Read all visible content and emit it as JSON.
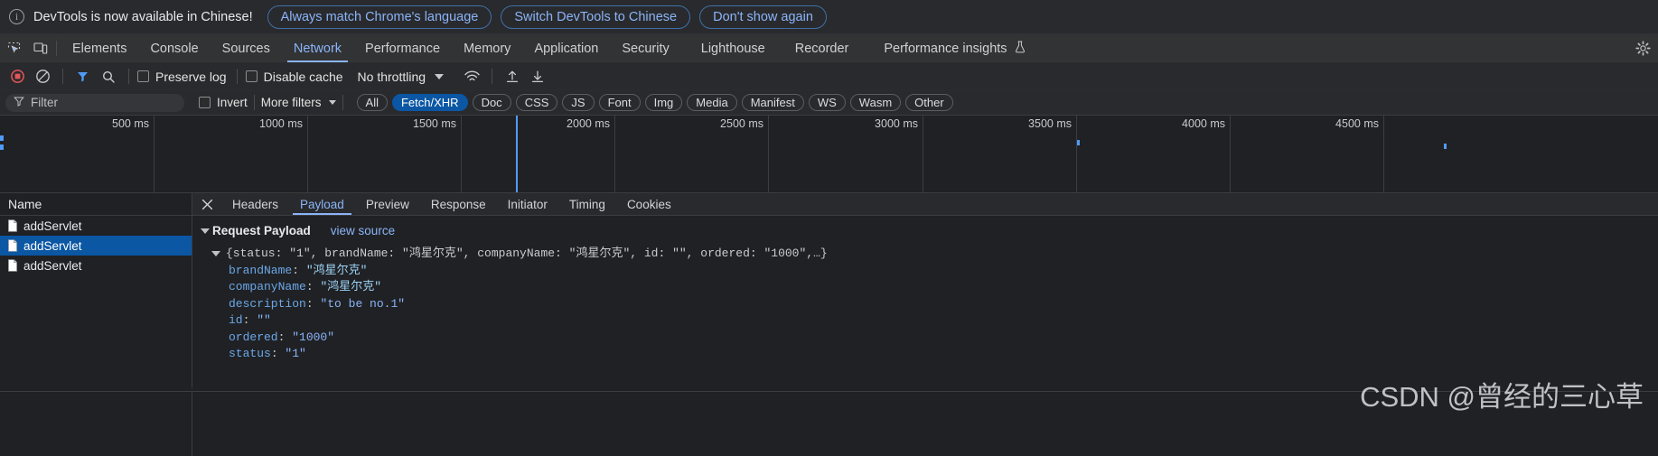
{
  "infobar": {
    "message": "DevTools is now available in Chinese!",
    "icon": "info-icon",
    "buttons": [
      "Always match Chrome's language",
      "Switch DevTools to Chinese",
      "Don't show again"
    ]
  },
  "tabbar": {
    "inspect_icon": "inspect-element-icon",
    "device_icon": "device-toolbar-icon",
    "settings_icon": "gear-icon",
    "tabs": [
      {
        "label": "Elements",
        "active": false
      },
      {
        "label": "Console",
        "active": false
      },
      {
        "label": "Sources",
        "active": false
      },
      {
        "label": "Network",
        "active": true
      },
      {
        "label": "Performance",
        "active": false
      },
      {
        "label": "Memory",
        "active": false
      },
      {
        "label": "Application",
        "active": false
      },
      {
        "label": "Security",
        "active": false
      },
      {
        "label": "Lighthouse",
        "active": false
      },
      {
        "label": "Recorder",
        "active": false
      },
      {
        "label": "Performance insights",
        "active": false,
        "icon": "flask-icon"
      }
    ]
  },
  "network_toolbar": {
    "record_icon": "record-stop-icon",
    "clear_icon": "clear-network-log-icon",
    "filter_icon": "filter-icon",
    "search_icon": "search-icon",
    "preserve_log": {
      "label": "Preserve log",
      "checked": false
    },
    "disable_cache": {
      "label": "Disable cache",
      "checked": false
    },
    "throttling": {
      "value": "No throttling",
      "caret": "chevron-down-icon"
    },
    "wifi_icon": "network-conditions-icon",
    "import_icon": "import-har-icon",
    "export_icon": "export-har-icon"
  },
  "filter_bar": {
    "search_icon": "filter-funnel-icon",
    "placeholder": "Filter",
    "value": "",
    "invert": {
      "label": "Invert",
      "checked": false
    },
    "more_filters": {
      "label": "More filters",
      "caret": "chevron-down-icon"
    },
    "type_pills": [
      {
        "label": "All",
        "selected": false
      },
      {
        "label": "Fetch/XHR",
        "selected": true
      },
      {
        "label": "Doc",
        "selected": false
      },
      {
        "label": "CSS",
        "selected": false
      },
      {
        "label": "JS",
        "selected": false
      },
      {
        "label": "Font",
        "selected": false
      },
      {
        "label": "Img",
        "selected": false
      },
      {
        "label": "Media",
        "selected": false
      },
      {
        "label": "Manifest",
        "selected": false
      },
      {
        "label": "WS",
        "selected": false
      },
      {
        "label": "Wasm",
        "selected": false
      },
      {
        "label": "Other",
        "selected": false
      }
    ],
    "accent_selected": "#0b57a4"
  },
  "timeline": {
    "ticks": [
      "500 ms",
      "1000 ms",
      "1500 ms",
      "2000 ms",
      "2500 ms",
      "3000 ms",
      "3500 ms",
      "4000 ms",
      "4500 ms"
    ],
    "marker_color": "#4f9bf5"
  },
  "requests_pane": {
    "column_header": "Name",
    "rows": [
      {
        "name": "addServlet",
        "selected": false,
        "icon": "document-icon"
      },
      {
        "name": "addServlet",
        "selected": true,
        "icon": "document-icon"
      },
      {
        "name": "addServlet",
        "selected": false,
        "icon": "document-icon"
      }
    ]
  },
  "detail_pane": {
    "close_icon": "close-icon",
    "tabs": [
      {
        "label": "Headers",
        "active": false
      },
      {
        "label": "Payload",
        "active": true
      },
      {
        "label": "Preview",
        "active": false
      },
      {
        "label": "Response",
        "active": false
      },
      {
        "label": "Initiator",
        "active": false
      },
      {
        "label": "Timing",
        "active": false
      },
      {
        "label": "Cookies",
        "active": false
      }
    ],
    "payload": {
      "section_title": "Request Payload",
      "view_source_label": "view source",
      "summary_line": "{status: \"1\", brandName: \"鸿星尔克\", companyName: \"鸿星尔克\", id: \"\", ordered: \"1000\",…}",
      "entries": [
        {
          "key": "brandName",
          "value": "\"鸿星尔克\"",
          "cjk": true
        },
        {
          "key": "companyName",
          "value": "\"鸿星尔克\"",
          "cjk": true
        },
        {
          "key": "description",
          "value": "\"to be no.1\"",
          "cjk": false
        },
        {
          "key": "id",
          "value": "\"\"",
          "cjk": false
        },
        {
          "key": "ordered",
          "value": "\"1000\"",
          "cjk": false
        },
        {
          "key": "status",
          "value": "\"1\"",
          "cjk": false
        }
      ]
    }
  },
  "watermark": "CSDN @曾经的三心草"
}
